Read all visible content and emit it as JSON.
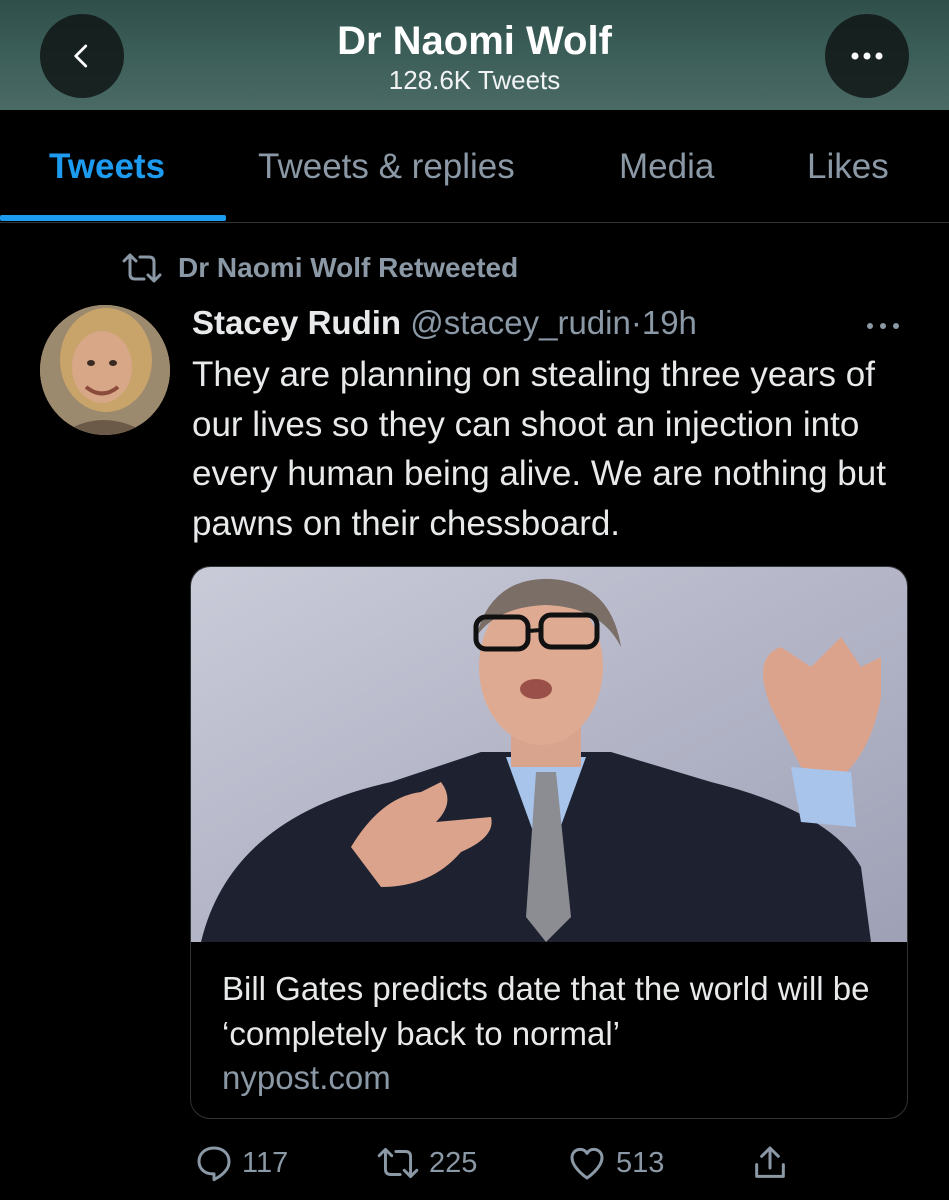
{
  "header": {
    "title": "Dr Naomi Wolf",
    "subtitle": "128.6K Tweets"
  },
  "tabs": [
    {
      "label": "Tweets",
      "active": true
    },
    {
      "label": "Tweets & replies",
      "active": false
    },
    {
      "label": "Media",
      "active": false
    },
    {
      "label": "Likes",
      "active": false
    }
  ],
  "tweet": {
    "retweeted_by": "Dr Naomi Wolf Retweeted",
    "author_name": "Stacey Rudin",
    "author_handle": "@stacey_rudin",
    "separator": "·",
    "time": "19h",
    "text": "They are planning on stealing three years of our lives so they can shoot an injection into every human being alive. We are nothing but pawns on their chessboard.",
    "card": {
      "title": "Bill Gates predicts date that the world will be ‘completely back to normal’",
      "domain": "nypost.com"
    },
    "actions": {
      "replies": "117",
      "retweets": "225",
      "likes": "513"
    }
  },
  "colors": {
    "accent": "#1d9bf0",
    "secondary_text": "#8b98a5",
    "background": "#000000"
  },
  "icons": [
    "back-arrow-icon",
    "more-icon",
    "retweet-icon",
    "reply-icon",
    "heart-icon",
    "share-icon"
  ]
}
